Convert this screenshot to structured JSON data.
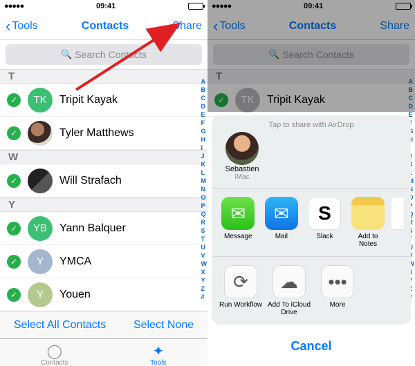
{
  "status": {
    "time": "09:41",
    "signal": "●●●●●"
  },
  "nav": {
    "back": "Tools",
    "title": "Contacts",
    "share": "Share"
  },
  "search": {
    "placeholder": "Search Contacts"
  },
  "sections": {
    "t": "T",
    "w": "W",
    "y": "Y"
  },
  "contacts": {
    "t1": {
      "initials": "TK",
      "name": "Tripit Kayak"
    },
    "t2": {
      "name": "Tyler Matthews"
    },
    "w1": {
      "name": "Will Strafach"
    },
    "y1": {
      "initials": "YB",
      "name": "Yann Balquer"
    },
    "y2": {
      "initials": "Y",
      "name": "YMCA"
    },
    "y3": {
      "initials": "Y",
      "name": "Youen"
    }
  },
  "index": [
    "A",
    "B",
    "C",
    "D",
    "E",
    "F",
    "G",
    "H",
    "I",
    "J",
    "K",
    "L",
    "M",
    "N",
    "O",
    "P",
    "Q",
    "R",
    "S",
    "T",
    "U",
    "V",
    "W",
    "X",
    "Y",
    "Z",
    "#"
  ],
  "actions": {
    "select_all": "Select All Contacts",
    "select_none": "Select None"
  },
  "tabs": {
    "contacts": "Contacts",
    "tools": "Tools"
  },
  "sheet": {
    "airdrop_hint": "Tap to share with AirDrop",
    "airdrop": {
      "name": "Sebastien",
      "device": "iMac"
    },
    "apps": {
      "message": "Message",
      "mail": "Mail",
      "slack": "Slack",
      "notes": "Add to Notes"
    },
    "actions": {
      "workflow": "Run Workflow",
      "icloud": "Add To iCloud Drive",
      "more": "More"
    },
    "cancel": "Cancel"
  }
}
